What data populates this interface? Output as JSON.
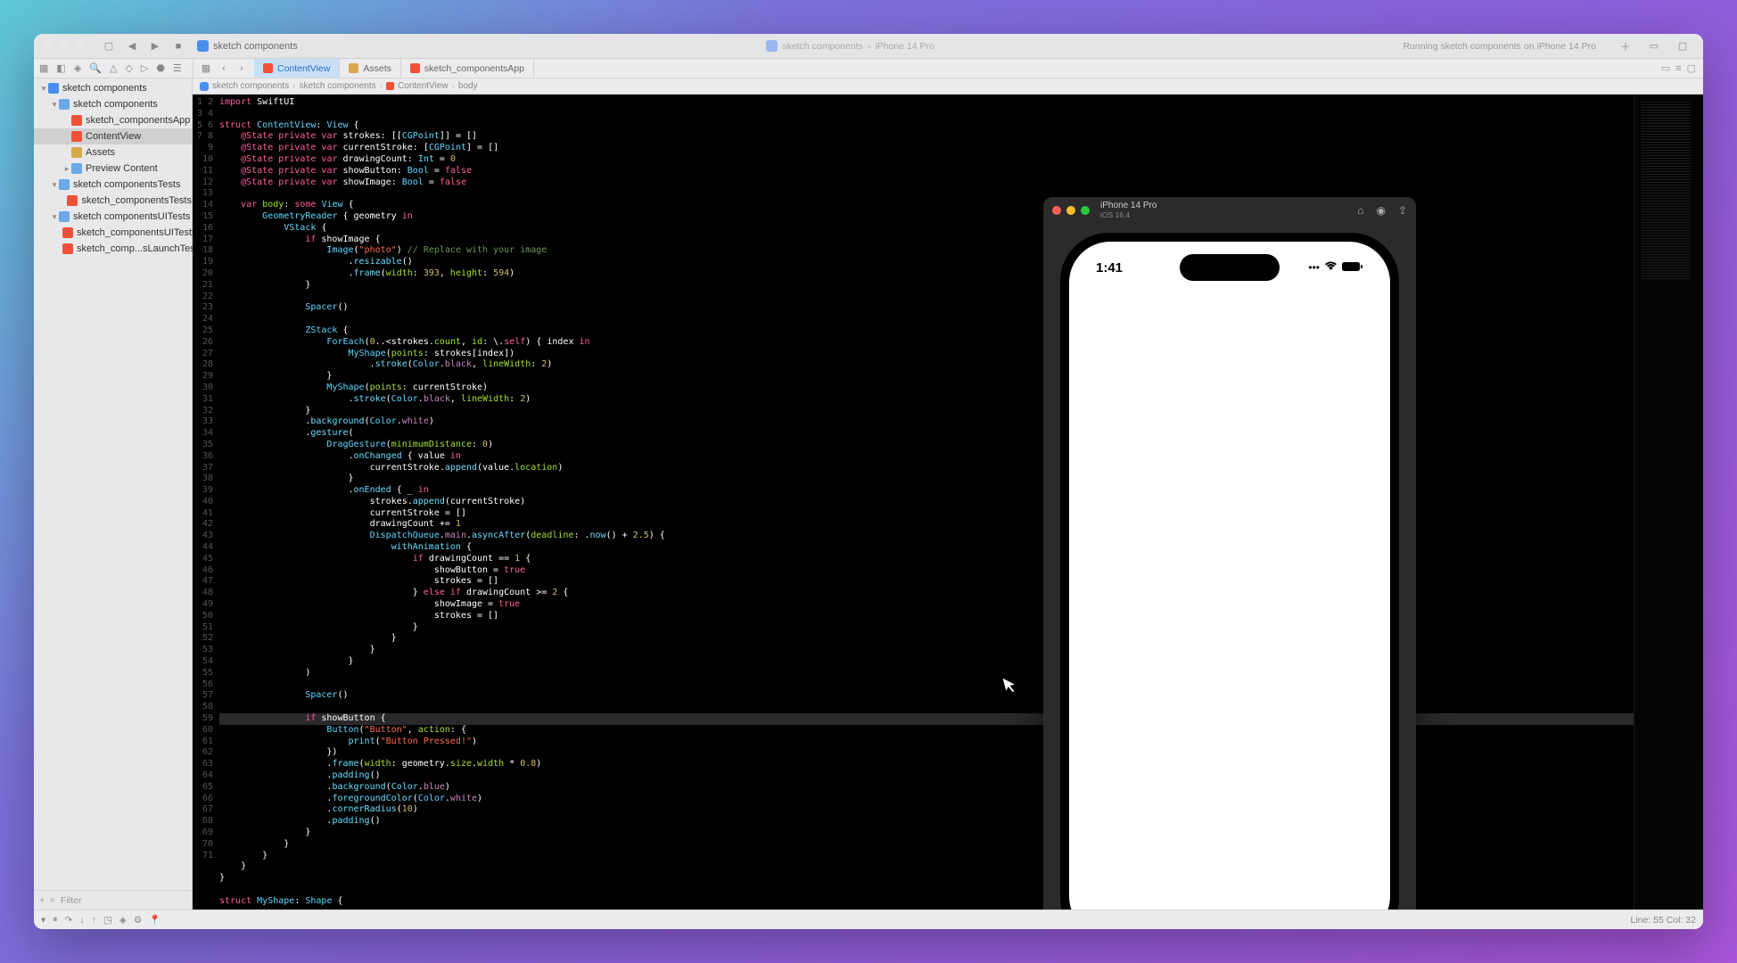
{
  "titlebar": {
    "project_name": "sketch components",
    "center_tab1": "sketch components",
    "center_tab2": "iPhone 14 Pro",
    "status": "Running sketch components on iPhone 14 Pro"
  },
  "tabbar": {
    "tab_active": "ContentView",
    "tab2": "Assets",
    "tab3": "sketch_componentsApp"
  },
  "breadcrumb": {
    "p1": "sketch components",
    "p2": "sketch components",
    "p3": "ContentView",
    "p4": "body"
  },
  "navigator": {
    "root": "sketch components",
    "g1": "sketch components",
    "f1": "sketch_componentsApp",
    "f2": "ContentView",
    "f3": "Assets",
    "f4": "Preview Content",
    "g2": "sketch componentsTests",
    "f5": "sketch_componentsTests",
    "g3": "sketch componentsUITests",
    "f6": "sketch_componentsUITests",
    "f7": "sketch_comp...sLaunchTests",
    "filter_placeholder": "Filter"
  },
  "code": {
    "lines": [
      {
        "n": 1,
        "html": "<span class='kw'>import</span> <span class='id'>SwiftUI</span>"
      },
      {
        "n": 2,
        "html": ""
      },
      {
        "n": 3,
        "html": "<span class='kw'>struct</span> <span class='type'>ContentView</span>: <span class='type'>View</span> {"
      },
      {
        "n": 4,
        "html": "    <span class='kw'>@State</span> <span class='kw'>private var</span> <span class='id'>strokes</span>: [[<span class='type'>CGPoint</span>]] = []"
      },
      {
        "n": 5,
        "html": "    <span class='kw'>@State</span> <span class='kw'>private var</span> <span class='id'>currentStroke</span>: [<span class='type'>CGPoint</span>] = []"
      },
      {
        "n": 6,
        "html": "    <span class='kw'>@State</span> <span class='kw'>private var</span> <span class='id'>drawingCount</span>: <span class='type'>Int</span> = <span class='num'>0</span>"
      },
      {
        "n": 7,
        "html": "    <span class='kw'>@State</span> <span class='kw'>private var</span> <span class='id'>showButton</span>: <span class='type'>Bool</span> = <span class='lit'>false</span>"
      },
      {
        "n": 8,
        "html": "    <span class='kw'>@State</span> <span class='kw'>private var</span> <span class='id'>showImage</span>: <span class='type'>Bool</span> = <span class='lit'>false</span>"
      },
      {
        "n": 9,
        "html": ""
      },
      {
        "n": 10,
        "html": "    <span class='kw'>var</span> <span class='prop'>body</span>: <span class='kw'>some</span> <span class='type'>View</span> {"
      },
      {
        "n": 11,
        "html": "        <span class='type'>GeometryReader</span> { geometry <span class='kw'>in</span>"
      },
      {
        "n": 12,
        "html": "            <span class='type'>VStack</span> {"
      },
      {
        "n": 13,
        "html": "                <span class='kw'>if</span> showImage {"
      },
      {
        "n": 14,
        "html": "                    <span class='type'>Image</span>(<span class='str'>\"photo\"</span>) <span class='cmt'>// Replace with your image</span>"
      },
      {
        "n": 15,
        "html": "                        .<span class='fn'>resizable</span>()"
      },
      {
        "n": 16,
        "html": "                        .<span class='fn'>frame</span>(<span class='prop'>width</span>: <span class='num'>393</span>, <span class='prop'>height</span>: <span class='num'>594</span>)"
      },
      {
        "n": 17,
        "html": "                }"
      },
      {
        "n": 18,
        "html": ""
      },
      {
        "n": 19,
        "html": "                <span class='type'>Spacer</span>()"
      },
      {
        "n": 20,
        "html": ""
      },
      {
        "n": 21,
        "html": "                <span class='type'>ZStack</span> {"
      },
      {
        "n": 22,
        "html": "                    <span class='type'>ForEach</span>(<span class='num'>0</span>..&lt;<span class='id'>strokes</span>.<span class='prop'>count</span>, <span class='prop'>id</span>: \\.<span class='kw'>self</span>) { index <span class='kw'>in</span>"
      },
      {
        "n": 23,
        "html": "                        <span class='type'>MyShape</span>(<span class='prop'>points</span>: strokes[index])"
      },
      {
        "n": 24,
        "html": "                            .<span class='fn'>stroke</span>(<span class='type'>Color</span>.<span class='pu'>black</span>, <span class='prop'>lineWidth</span>: <span class='num'>2</span>)"
      },
      {
        "n": 25,
        "html": "                    }"
      },
      {
        "n": 26,
        "html": "                    <span class='type'>MyShape</span>(<span class='prop'>points</span>: currentStroke)"
      },
      {
        "n": 27,
        "html": "                        .<span class='fn'>stroke</span>(<span class='type'>Color</span>.<span class='pu'>black</span>, <span class='prop'>lineWidth</span>: <span class='num'>2</span>)"
      },
      {
        "n": 28,
        "html": "                }"
      },
      {
        "n": 29,
        "html": "                .<span class='fn'>background</span>(<span class='type'>Color</span>.<span class='pu'>white</span>)"
      },
      {
        "n": 30,
        "html": "                .<span class='fn'>gesture</span>("
      },
      {
        "n": 31,
        "html": "                    <span class='type'>DragGesture</span>(<span class='prop'>minimumDistance</span>: <span class='num'>0</span>)"
      },
      {
        "n": 32,
        "html": "                        .<span class='fn'>onChanged</span> { value <span class='kw'>in</span>"
      },
      {
        "n": 33,
        "html": "                            currentStroke.<span class='fn'>append</span>(value.<span class='prop'>location</span>)"
      },
      {
        "n": 34,
        "html": "                        }"
      },
      {
        "n": 35,
        "html": "                        .<span class='fn'>onEnded</span> { _ <span class='kw'>in</span>"
      },
      {
        "n": 36,
        "html": "                            strokes.<span class='fn'>append</span>(currentStroke)"
      },
      {
        "n": 37,
        "html": "                            currentStroke = []"
      },
      {
        "n": 38,
        "html": "                            drawingCount += <span class='num'>1</span>"
      },
      {
        "n": 39,
        "html": "                            <span class='type'>DispatchQueue</span>.<span class='pu'>main</span>.<span class='fn'>asyncAfter</span>(<span class='prop'>deadline</span>: .<span class='fn'>now</span>() + <span class='num'>2.5</span>) {"
      },
      {
        "n": 40,
        "html": "                                <span class='fn'>withAnimation</span> {"
      },
      {
        "n": 41,
        "html": "                                    <span class='kw'>if</span> drawingCount == <span class='num'>1</span> {"
      },
      {
        "n": 42,
        "html": "                                        showButton = <span class='lit'>true</span>"
      },
      {
        "n": 43,
        "html": "                                        strokes = []"
      },
      {
        "n": 44,
        "html": "                                    } <span class='kw'>else if</span> drawingCount &gt;= <span class='num'>2</span> {"
      },
      {
        "n": 45,
        "html": "                                        showImage = <span class='lit'>true</span>"
      },
      {
        "n": 46,
        "html": "                                        strokes = []"
      },
      {
        "n": 47,
        "html": "                                    }"
      },
      {
        "n": 48,
        "html": "                                }"
      },
      {
        "n": 49,
        "html": "                            }"
      },
      {
        "n": 50,
        "html": "                        }"
      },
      {
        "n": 51,
        "html": "                )"
      },
      {
        "n": 52,
        "html": ""
      },
      {
        "n": 53,
        "html": "                <span class='type'>Spacer</span>()"
      },
      {
        "n": 54,
        "html": ""
      },
      {
        "n": 55,
        "html": "                <span class='kw'>if</span> showButton {",
        "hl": true
      },
      {
        "n": 56,
        "html": "                    <span class='type'>Button</span>(<span class='str'>\"Button\"</span>, <span class='prop'>action</span>: {"
      },
      {
        "n": 57,
        "html": "                        <span class='fn'>print</span>(<span class='str'>\"Button Pressed!\"</span>)"
      },
      {
        "n": 58,
        "html": "                    })"
      },
      {
        "n": 59,
        "html": "                    .<span class='fn'>frame</span>(<span class='prop'>width</span>: geometry.<span class='prop'>size</span>.<span class='prop'>width</span> * <span class='num'>0.8</span>)"
      },
      {
        "n": 60,
        "html": "                    .<span class='fn'>padding</span>()"
      },
      {
        "n": 61,
        "html": "                    .<span class='fn'>background</span>(<span class='type'>Color</span>.<span class='pu'>blue</span>)"
      },
      {
        "n": 62,
        "html": "                    .<span class='fn'>foregroundColor</span>(<span class='type'>Color</span>.<span class='pu'>white</span>)"
      },
      {
        "n": 63,
        "html": "                    .<span class='fn'>cornerRadius</span>(<span class='num'>10</span>)"
      },
      {
        "n": 64,
        "html": "                    .<span class='fn'>padding</span>()"
      },
      {
        "n": 65,
        "html": "                }"
      },
      {
        "n": 66,
        "html": "            }"
      },
      {
        "n": 67,
        "html": "        }"
      },
      {
        "n": 68,
        "html": "    }"
      },
      {
        "n": 69,
        "html": "}"
      },
      {
        "n": 70,
        "html": ""
      },
      {
        "n": 71,
        "html": "<span class='kw'>struct</span> <span class='type'>MyShape</span>: <span class='type'>Shape</span> {"
      }
    ]
  },
  "simulator": {
    "device": "iPhone 14 Pro",
    "os": "iOS 16.4",
    "time": "1:41"
  },
  "statusbar": {
    "position": "Line: 55  Col: 32"
  }
}
